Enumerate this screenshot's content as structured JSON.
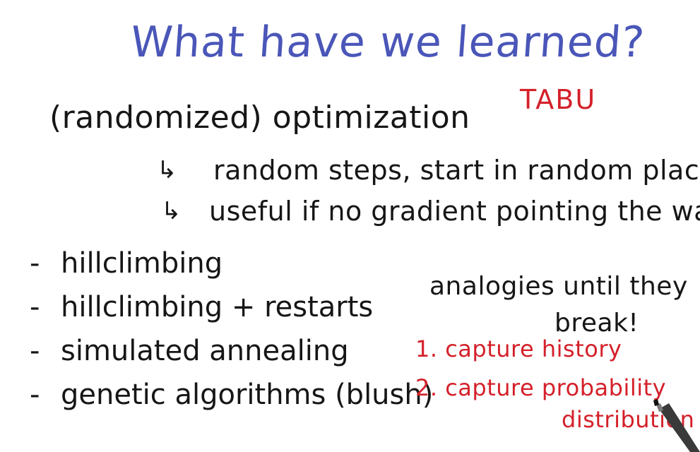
{
  "title": "What have we learned?",
  "tabu": "TABU",
  "topic": "(randomized) optimization",
  "arrow_glyph": "↳",
  "sub_points": [
    "random steps, start in random places",
    "useful if no gradient pointing the way."
  ],
  "dash_glyph": "-",
  "methods": [
    "hillclimbing",
    "hillclimbing + restarts",
    "simulated annealing",
    "genetic algorithms (blush)"
  ],
  "analogies_line1": "analogies until they",
  "analogies_line2": "break!",
  "red_notes": [
    "1. capture history",
    "2. capture probability",
    "distribution"
  ],
  "colors": {
    "title": "#4a56b8",
    "body": "#161616",
    "accent": "#d4202a"
  },
  "icons": {
    "pen": "pen-tip-icon",
    "arrow": "arrow-return-icon"
  }
}
